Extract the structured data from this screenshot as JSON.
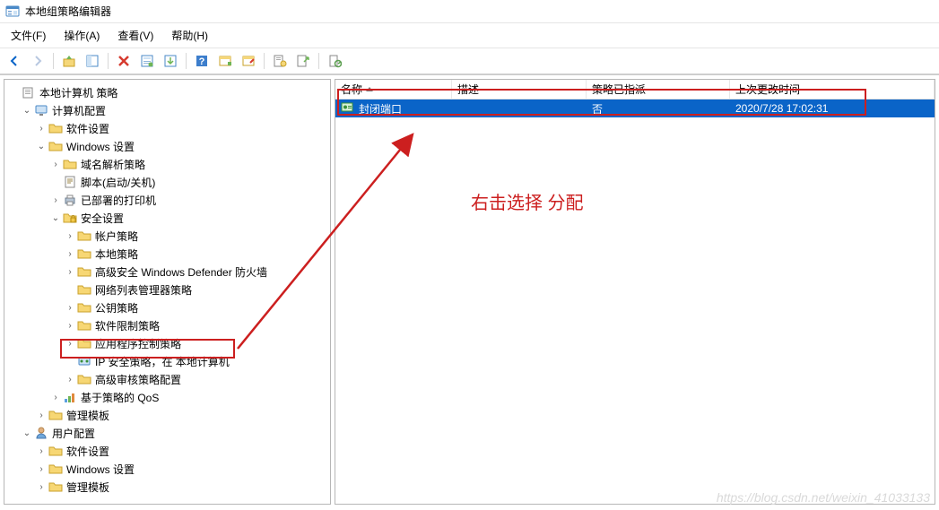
{
  "window": {
    "title": "本地组策略编辑器"
  },
  "menu": {
    "file": "文件(F)",
    "action": "操作(A)",
    "view": "查看(V)",
    "help": "帮助(H)"
  },
  "tree": {
    "root": "本地计算机 策略",
    "computer_config": "计算机配置",
    "software_settings": "软件设置",
    "windows_settings": "Windows 设置",
    "dns_policy": "域名解析策略",
    "scripts": "脚本(启动/关机)",
    "deployed_printers": "已部署的打印机",
    "security_settings": "安全设置",
    "account_policy": "帐户策略",
    "local_policy": "本地策略",
    "defender": "高级安全 Windows Defender 防火墙",
    "network_list": "网络列表管理器策略",
    "public_key": "公钥策略",
    "software_restriction": "软件限制策略",
    "app_control": "应用程序控制策略",
    "ip_security": "IP 安全策略，在 本地计算机",
    "audit_policy": "高级审核策略配置",
    "qos": "基于策略的 QoS",
    "admin_templates": "管理模板",
    "user_config": "用户配置",
    "user_software": "软件设置",
    "user_windows": "Windows 设置",
    "user_admin_templates": "管理模板"
  },
  "list": {
    "headers": {
      "name": "名称",
      "desc": "描述",
      "assigned": "策略已指派",
      "modified": "上次更改时间"
    },
    "rows": [
      {
        "name": "封闭端口",
        "desc": "",
        "assigned": "否",
        "modified": "2020/7/28 17:02:31"
      }
    ]
  },
  "annotation": {
    "text": "右击选择 分配"
  },
  "watermark": "https://blog.csdn.net/weixin_41033133"
}
